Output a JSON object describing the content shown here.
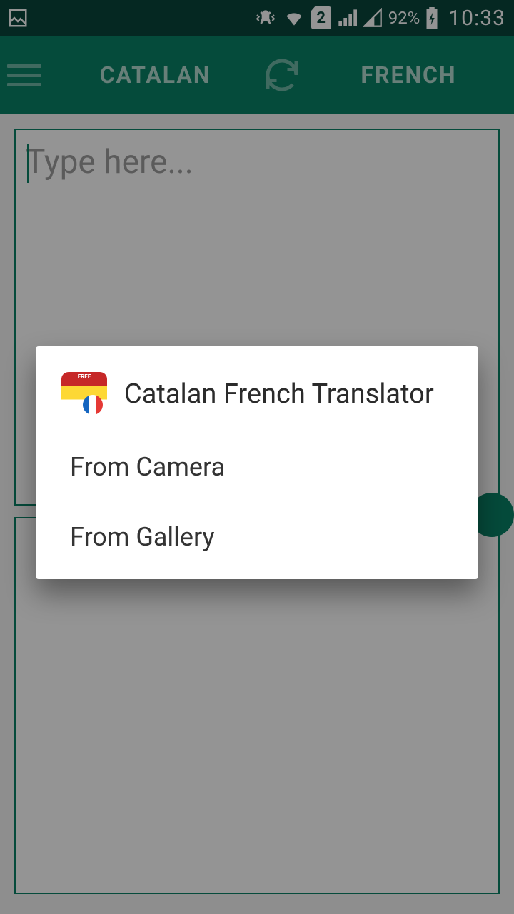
{
  "status": {
    "battery": "92%",
    "time": "10:33",
    "sim": "2"
  },
  "header": {
    "source_lang": "CATALAN",
    "target_lang": "FRENCH"
  },
  "input": {
    "placeholder": "Type here..."
  },
  "dialog": {
    "title": "Catalan French Translator",
    "options": [
      "From Camera",
      "From Gallery"
    ]
  }
}
